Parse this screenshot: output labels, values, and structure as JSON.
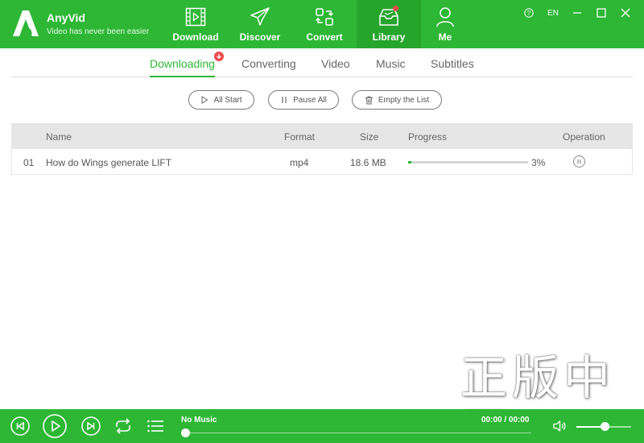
{
  "app": {
    "name": "AnyVid",
    "slogan": "Video has never been easier"
  },
  "nav": {
    "items": [
      {
        "label": "Download",
        "icon": "film-download-icon"
      },
      {
        "label": "Discover",
        "icon": "paper-plane-icon"
      },
      {
        "label": "Convert",
        "icon": "convert-arrows-icon"
      },
      {
        "label": "Library",
        "icon": "library-inbox-icon",
        "active": true,
        "has_notification_dot": true
      },
      {
        "label": "Me",
        "icon": "user-icon"
      }
    ]
  },
  "window_controls": {
    "help_label": "?",
    "language": "EN",
    "icons": [
      "help-icon",
      "minimize-icon",
      "maximize-icon",
      "close-icon"
    ]
  },
  "tabs": {
    "items": [
      "Downloading",
      "Converting",
      "Video",
      "Music",
      "Subtitles"
    ],
    "active": "Downloading"
  },
  "toolbar": {
    "all_start": "All Start",
    "pause_all": "Pause All",
    "empty_list": "Empty the List"
  },
  "table": {
    "headers": {
      "name": "Name",
      "format": "Format",
      "size": "Size",
      "progress": "Progress",
      "operation": "Operation"
    },
    "rows": [
      {
        "index": "01",
        "name": "How do Wings generate LIFT",
        "format": "mp4",
        "size": "18.6 MB",
        "progress": 0.03,
        "progress_label": "3%"
      }
    ]
  },
  "watermark": "正版中国",
  "player": {
    "track_title": "No Music",
    "time": "00:00 / 00:00",
    "seek_position": 0,
    "volume": 0.5
  },
  "colors": {
    "brand_green": "#2db735",
    "active_nav_bg": "#26a52d",
    "notification_red": "#ee4a4a",
    "header_row_bg": "#e6e6e6"
  }
}
